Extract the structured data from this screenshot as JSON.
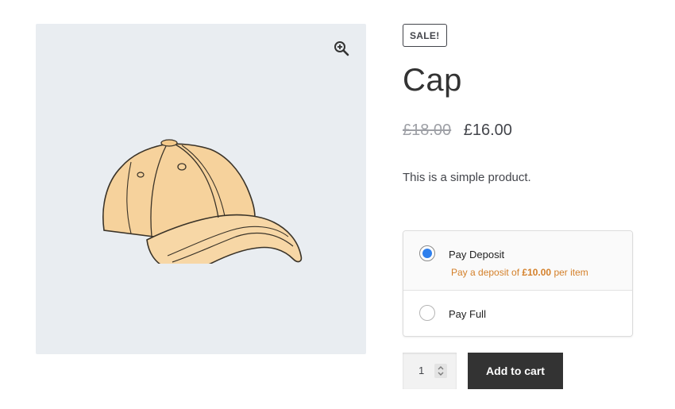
{
  "product": {
    "sale_badge": "SALE!",
    "title": "Cap",
    "price_regular": "£18.00",
    "price_sale": "£16.00",
    "short_description": "This is a simple product."
  },
  "gallery": {
    "zoom_icon": "zoom-in-icon",
    "image_subject": "cap"
  },
  "payment_options": {
    "deposit_label": "Pay Deposit",
    "deposit_note_prefix": "Pay a deposit of",
    "deposit_amount": "£10.00",
    "deposit_note_suffix": "per item",
    "full_label": "Pay Full",
    "selected": "deposit"
  },
  "cart": {
    "quantity": "1",
    "add_to_cart_label": "Add to cart"
  },
  "colors": {
    "gallery_bg": "#e9edf1",
    "button_bg": "#333333",
    "deposit_note": "#d4802a",
    "radio_selected": "#2f80ed"
  }
}
